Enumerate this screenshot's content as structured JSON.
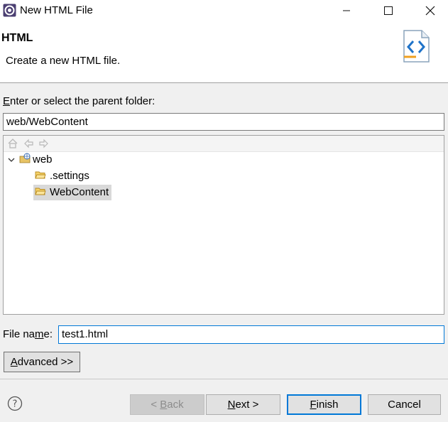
{
  "window": {
    "title": "New HTML File",
    "controls": [
      "minimize",
      "maximize",
      "close"
    ]
  },
  "header": {
    "title": "HTML",
    "description": "Create a new HTML file.",
    "wizard_icon": "html-file-icon"
  },
  "parent_folder": {
    "label_mnemonic": "E",
    "label_rest": "nter or select the parent folder:",
    "value": "web/WebContent"
  },
  "tree": {
    "toolbar": [
      "home-icon",
      "back-arrow-icon",
      "forward-arrow-icon"
    ],
    "items": [
      {
        "label": "web",
        "expanded": true,
        "icon": "project-icon"
      },
      {
        "label": ".settings",
        "icon": "folder-icon"
      },
      {
        "label": "WebContent",
        "icon": "folder-open-icon",
        "selected": true
      }
    ]
  },
  "file_name": {
    "label_pre": "File na",
    "label_mnemonic": "m",
    "label_post": "e:",
    "value": "test1.html"
  },
  "buttons": {
    "advanced": {
      "mnemonic": "A",
      "rest": "dvanced >>"
    },
    "back": {
      "pre": "< ",
      "mnemonic": "B",
      "rest": "ack",
      "enabled": false
    },
    "next": {
      "mnemonic": "N",
      "rest": "ext >"
    },
    "finish": {
      "mnemonic": "F",
      "rest": "inish",
      "default": true
    },
    "cancel": "Cancel"
  },
  "colors": {
    "accent": "#0078d7",
    "disabled_text": "#8c8c8c",
    "selection": "#d9d9d9"
  }
}
